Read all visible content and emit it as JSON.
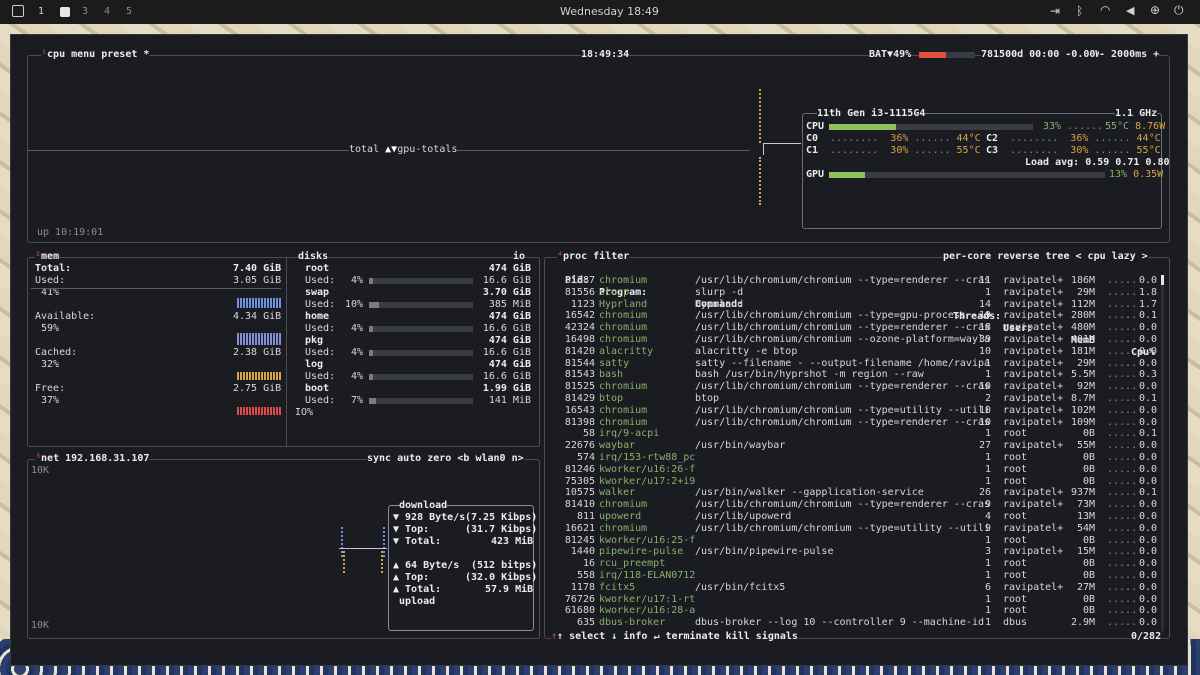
{
  "topbar": {
    "workspaces": [
      "1",
      "3",
      "4",
      "5"
    ],
    "clock": "Wednesday 18:49"
  },
  "cpu": {
    "hotkey": "¹",
    "title": "cpu",
    "menu": "menu",
    "preset": "preset *",
    "time": "18:49:34",
    "battery": "BAT▼49%",
    "battery_info": "781500d 00:00 -0.00W",
    "interval": "- 2000ms +",
    "graph_label": "total",
    "graph_mode": "gpu-totals",
    "uptime": "up 10:19:01",
    "model": "11th Gen i3-1115G4",
    "freq": "1.1 GHz",
    "cpu_pct": "33%",
    "cpu_temp": "55°C",
    "cpu_watts": "8.76W",
    "cores": [
      {
        "name": "C0",
        "pct": "36%",
        "temp": "44°C"
      },
      {
        "name": "C1",
        "pct": "30%",
        "temp": "55°C"
      },
      {
        "name": "C2",
        "pct": "36%",
        "temp": "44°C"
      },
      {
        "name": "C3",
        "pct": "30%",
        "temp": "55°C"
      }
    ],
    "load": "Load avg: 0.59 0.71 0.80",
    "gpu_label": "GPU",
    "gpu_pct": "13%",
    "gpu_watts": "0.35W",
    "cpu_level": 0.33,
    "gpu_level": 0.13
  },
  "mem": {
    "hotkey": "²",
    "title": "mem",
    "total_label": "Total:",
    "total": "7.40 GiB",
    "used_label": "Used:",
    "used": "3.05 GiB",
    "used_pct": "41%",
    "avail_label": "Available:",
    "avail": "4.34 GiB",
    "avail_pct": "59%",
    "cached_label": "Cached:",
    "cached": "2.38 GiB",
    "cached_pct": "32%",
    "free_label": "Free:",
    "free": "2.75 GiB",
    "free_pct": "37%"
  },
  "disks": {
    "title": "disks",
    "io": "io",
    "rows": [
      {
        "name": "root",
        "total": "474 GiB",
        "used_pct": "4%",
        "used": "16.6 GiB",
        "level": 0.04
      },
      {
        "name": "swap",
        "total": "3.70 GiB",
        "used_pct": "10%",
        "used": "385 MiB",
        "level": 0.1
      },
      {
        "name": "home",
        "total": "474 GiB",
        "used_pct": "4%",
        "used": "16.6 GiB",
        "level": 0.04
      },
      {
        "name": "pkg",
        "total": "474 GiB",
        "used_pct": "4%",
        "used": "16.6 GiB",
        "level": 0.04
      },
      {
        "name": "log",
        "total": "474 GiB",
        "used_pct": "4%",
        "used": "16.6 GiB",
        "level": 0.04
      },
      {
        "name": "boot",
        "total": "1.99 GiB",
        "used_pct": "7%",
        "used": "141 MiB",
        "level": 0.07
      }
    ],
    "io_label": "IO%",
    "used_label": "Used:"
  },
  "net": {
    "hotkey": "³",
    "title": "net",
    "ip": "192.168.31.107",
    "sync": "sync",
    "auto": "auto",
    "zero": "zero",
    "iface_prev": "<b",
    "iface": "wlan0",
    "iface_next": "n>",
    "scale_top": "10K",
    "scale_bottom": "10K",
    "download": "download",
    "dl_rate": "▼ 928 Byte/s",
    "dl_bits": "(7.25 Kibps)",
    "dl_top_label": "▼ Top:",
    "dl_top": "(31.7 Kibps)",
    "dl_total_label": "▼ Total:",
    "dl_total": "423 MiB",
    "ul_rate": "▲ 64 Byte/s",
    "ul_bits": "(512 bitps)",
    "ul_top_label": "▲ Top:",
    "ul_top": "(32.0 Kibps)",
    "ul_total_label": "▲ Total:",
    "ul_total": "57.9 MiB",
    "upload": "upload"
  },
  "proc": {
    "hotkey": "⁴",
    "title": "proc",
    "filter": "filter",
    "percore": "per-core",
    "reverse": "reverse",
    "tree": "tree",
    "lazy": "< cpu lazy >",
    "headers": {
      "pid": "Pid:",
      "program": "Program:",
      "command": "Command:",
      "threads": "Threads:",
      "user": "User:",
      "mem": "MemB",
      "cpu": "Cpu%"
    },
    "footer": {
      "select": "↑ select ↓",
      "info": "info ↵",
      "terminate": "terminate",
      "kill": "kill",
      "signals": "signals",
      "count": "0/282"
    },
    "rows": [
      [
        "81387",
        "chromium",
        "/usr/lib/chromium/chromium --type=renderer --cras",
        "11",
        "ravipatel+",
        "186M",
        "0.0"
      ],
      [
        "81556",
        "slurp",
        "slurp -d",
        "1",
        "ravipatel+",
        "29M",
        "1.8"
      ],
      [
        "1123",
        "Hyprland",
        "Hyprland",
        "14",
        "ravipatel+",
        "112M",
        "1.7"
      ],
      [
        "16542",
        "chromium",
        "/usr/lib/chromium/chromium --type=gpu-process --o",
        "19",
        "ravipatel+",
        "280M",
        "0.1"
      ],
      [
        "42324",
        "chromium",
        "/usr/lib/chromium/chromium --type=renderer --cras",
        "18",
        "ravipatel+",
        "480M",
        "0.0"
      ],
      [
        "16498",
        "chromium",
        "/usr/lib/chromium/chromium --ozone-platform=wayla",
        "39",
        "ravipatel+",
        "401M",
        "0.0"
      ],
      [
        "81420",
        "alacritty",
        "alacritty -e btop",
        "10",
        "ravipatel+",
        "181M",
        "0.0"
      ],
      [
        "81544",
        "satty",
        "satty --filename - --output-filename /home/ravipa",
        "1",
        "ravipatel+",
        "29M",
        "0.0"
      ],
      [
        "81543",
        "bash",
        "bash /usr/bin/hyprshot -m region --raw",
        "1",
        "ravipatel+",
        "5.5M",
        "0.3"
      ],
      [
        "81525",
        "chromium",
        "/usr/lib/chromium/chromium --type=renderer --cras",
        "10",
        "ravipatel+",
        "92M",
        "0.0"
      ],
      [
        "81429",
        "btop",
        "btop",
        "2",
        "ravipatel+",
        "8.7M",
        "0.1"
      ],
      [
        "16543",
        "chromium",
        "/usr/lib/chromium/chromium --type=utility --utili",
        "10",
        "ravipatel+",
        "102M",
        "0.0"
      ],
      [
        "81398",
        "chromium",
        "/usr/lib/chromium/chromium --type=renderer --cras",
        "10",
        "ravipatel+",
        "109M",
        "0.0"
      ],
      [
        "58",
        "irq/9-acpi",
        "",
        "1",
        "root",
        "0B",
        "0.1"
      ],
      [
        "22676",
        "waybar",
        "/usr/bin/waybar",
        "27",
        "ravipatel+",
        "55M",
        "0.0"
      ],
      [
        "574",
        "irq/153-rtw88_pc",
        "",
        "1",
        "root",
        "0B",
        "0.0"
      ],
      [
        "81246",
        "kworker/u16:26-f",
        "",
        "1",
        "root",
        "0B",
        "0.0"
      ],
      [
        "75305",
        "kworker/u17:2+i9",
        "",
        "1",
        "root",
        "0B",
        "0.0"
      ],
      [
        "10575",
        "walker",
        "/usr/bin/walker --gapplication-service",
        "26",
        "ravipatel+",
        "937M",
        "0.1"
      ],
      [
        "81410",
        "chromium",
        "/usr/lib/chromium/chromium --type=renderer --cras",
        "9",
        "ravipatel+",
        "73M",
        "0.0"
      ],
      [
        "811",
        "upowerd",
        "/usr/lib/upowerd",
        "4",
        "root",
        "13M",
        "0.0"
      ],
      [
        "16621",
        "chromium",
        "/usr/lib/chromium/chromium --type=utility --utili",
        "9",
        "ravipatel+",
        "54M",
        "0.0"
      ],
      [
        "81245",
        "kworker/u16:25-f",
        "",
        "1",
        "root",
        "0B",
        "0.0"
      ],
      [
        "1440",
        "pipewire-pulse",
        "/usr/bin/pipewire-pulse",
        "3",
        "ravipatel+",
        "15M",
        "0.0"
      ],
      [
        "16",
        "rcu_preempt",
        "",
        "1",
        "root",
        "0B",
        "0.0"
      ],
      [
        "558",
        "irq/118-ELAN0712",
        "",
        "1",
        "root",
        "0B",
        "0.0"
      ],
      [
        "1178",
        "fcitx5",
        "/usr/bin/fcitx5",
        "6",
        "ravipatel+",
        "27M",
        "0.0"
      ],
      [
        "76726",
        "kworker/u17:1-rt",
        "",
        "1",
        "root",
        "0B",
        "0.0"
      ],
      [
        "61680",
        "kworker/u16:28-a",
        "",
        "1",
        "root",
        "0B",
        "0.0"
      ],
      [
        "635",
        "dbus-broker",
        "dbus-broker --log 10 --controller 9 --machine-id",
        "1",
        "dbus",
        "2.9M",
        "0.0"
      ]
    ]
  }
}
